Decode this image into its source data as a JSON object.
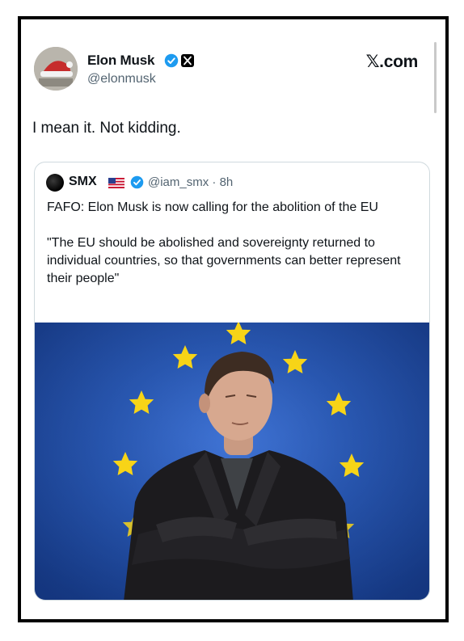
{
  "post": {
    "author_name": "Elon Musk",
    "author_handle": "@elonmusk",
    "site_label": "𝕏.com",
    "text": "I mean it. Not kidding."
  },
  "quoted": {
    "author_name": "SMX",
    "handle_time": "@iam_smx · 8h",
    "text_line1": "FAFO: Elon Musk is now calling for the abolition of the EU",
    "text_line2": "\"The EU should be abolished and sovereignty returned to individual countries, so that governments can better represent their people\""
  },
  "icons": {
    "verified": "verified-badge-icon",
    "affiliation": "x-logo-icon",
    "flag": "us-flag-icon"
  },
  "colors": {
    "verified_blue": "#1d9bf0",
    "handle_gray": "#536471",
    "flag_blue": "#2454b0",
    "star_yellow": "#f7d417"
  }
}
